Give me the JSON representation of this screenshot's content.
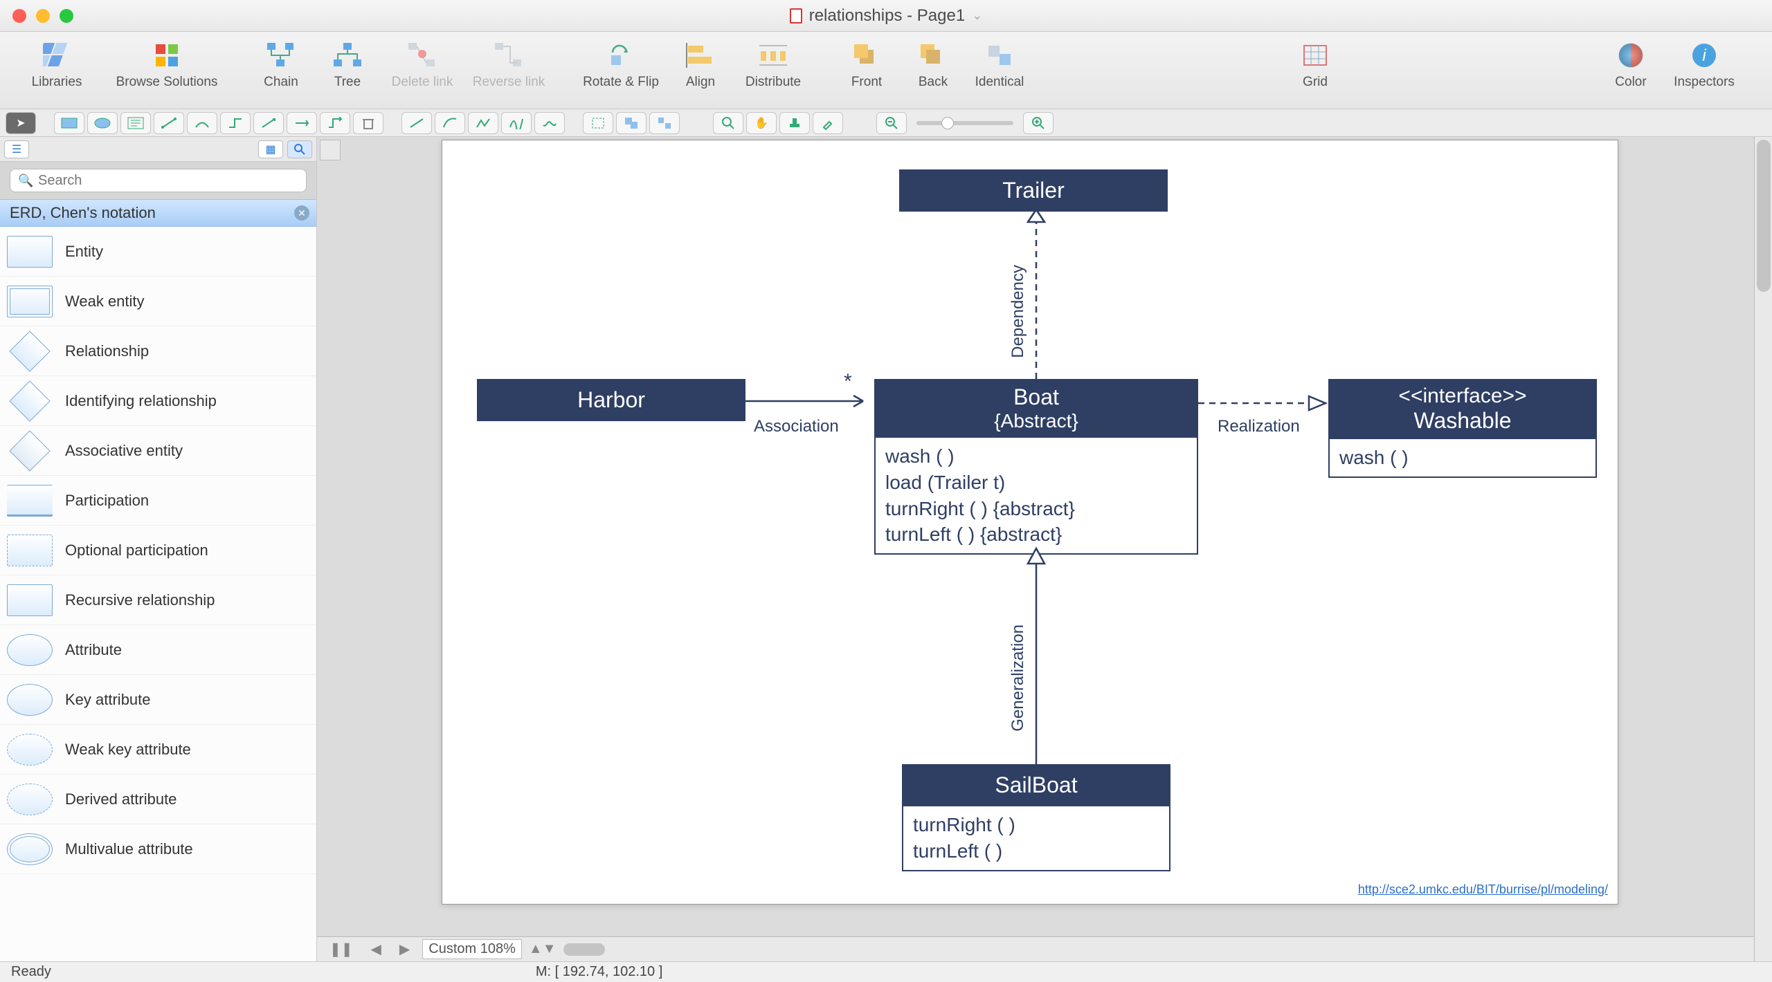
{
  "window": {
    "title": "relationships - Page1"
  },
  "toolbar": {
    "libraries": "Libraries",
    "browse": "Browse Solutions",
    "chain": "Chain",
    "tree": "Tree",
    "delete_link": "Delete link",
    "reverse_link": "Reverse link",
    "rotate_flip": "Rotate & Flip",
    "align": "Align",
    "distribute": "Distribute",
    "front": "Front",
    "back": "Back",
    "identical": "Identical",
    "grid": "Grid",
    "color": "Color",
    "inspectors": "Inspectors"
  },
  "sidebar": {
    "search_placeholder": "Search",
    "section_title": "ERD, Chen's notation",
    "items": [
      "Entity",
      "Weak entity",
      "Relationship",
      "Identifying relationship",
      "Associative entity",
      "Participation",
      "Optional participation",
      "Recursive relationship",
      "Attribute",
      "Key attribute",
      "Weak key attribute",
      "Derived attribute",
      "Multivalue attribute"
    ]
  },
  "pager": {
    "zoom_label": "Custom 108%"
  },
  "status": {
    "left": "Ready",
    "mouse": "M: [ 192.74, 102.10 ]"
  },
  "diagram": {
    "trailer": "Trailer",
    "harbor": "Harbor",
    "boat_title": "Boat",
    "boat_sub": "{Abstract}",
    "boat_ops": [
      "wash ( )",
      "load (Trailer t)",
      "turnRight ( ) {abstract}",
      "turnLeft ( ) {abstract}"
    ],
    "washable_stereo": "<<interface>>",
    "washable_name": "Washable",
    "washable_ops": [
      "wash ( )"
    ],
    "sailboat": "SailBoat",
    "sailboat_ops": [
      "turnRight ( )",
      "turnLeft ( )"
    ],
    "assoc_label": "Association",
    "assoc_mult": "*",
    "dep_label": "Dependency",
    "real_label": "Realization",
    "gen_label": "Generalization",
    "link": "http://sce2.umkc.edu/BIT/burrise/pl/modeling/"
  }
}
